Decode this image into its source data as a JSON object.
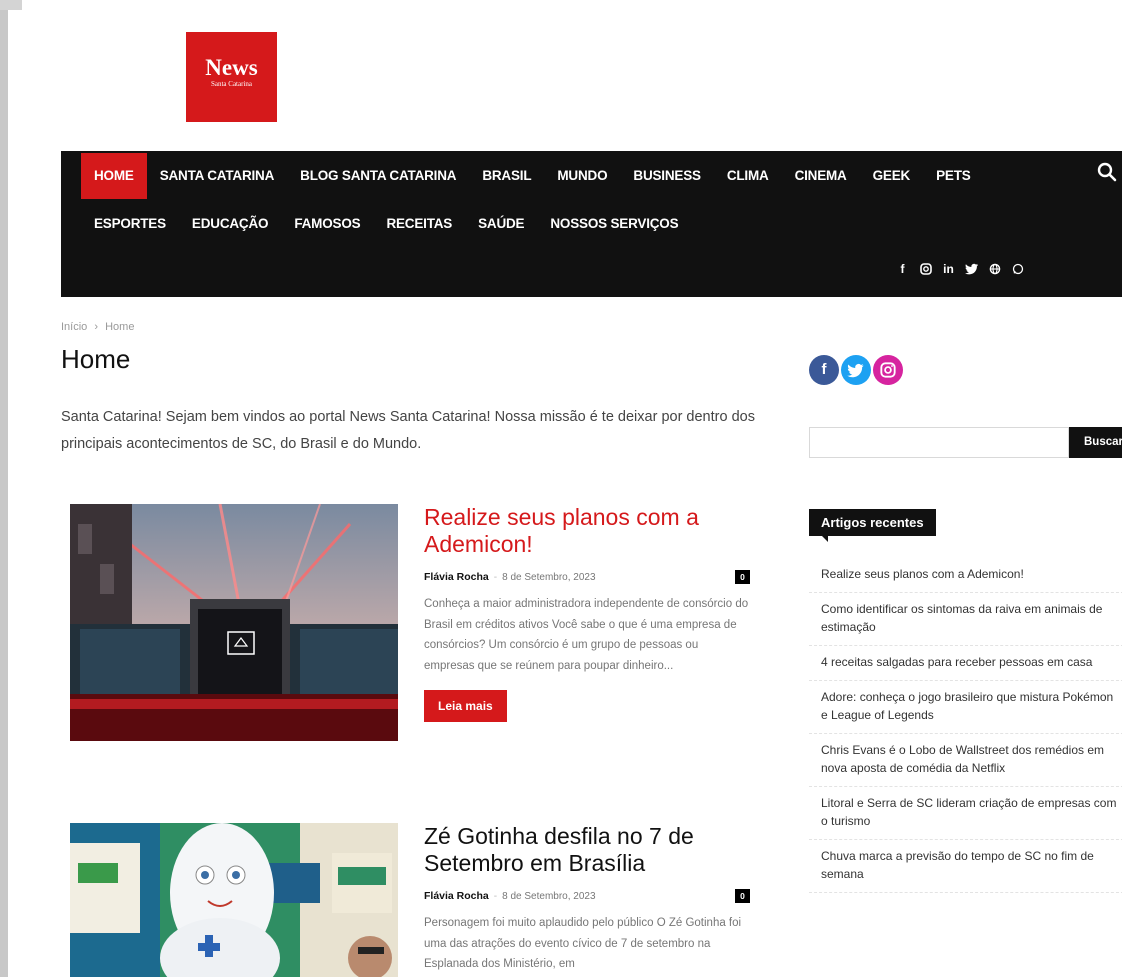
{
  "logo": {
    "main": "News",
    "sub": "Santa Catarina"
  },
  "nav": {
    "row1": [
      "HOME",
      "SANTA CATARINA",
      "BLOG SANTA CATARINA",
      "BRASIL",
      "MUNDO",
      "BUSINESS",
      "CLIMA",
      "CINEMA",
      "GEEK",
      "PETS"
    ],
    "row2": [
      "ESPORTES",
      "EDUCAÇÃO",
      "FAMOSOS",
      "RECEITAS",
      "SAÚDE",
      "NOSSOS SERVIÇOS"
    ],
    "active": "HOME",
    "social_icons": [
      "facebook-icon",
      "instagram-icon",
      "linkedin-icon",
      "twitter-icon",
      "globe-icon",
      "whatsapp-icon"
    ]
  },
  "breadcrumb": {
    "home": "Início",
    "separator": "›",
    "current": "Home"
  },
  "page_title": "Home",
  "intro": "Santa Catarina! Sejam bem vindos ao portal News Santa Catarina! Nossa missão é te deixar por dentro dos principais acontecimentos de SC, do Brasil e do Mundo.",
  "posts": [
    {
      "title": "Realize seus planos com a Ademicon!",
      "author": "Flávia Rocha",
      "date": "8 de Setembro, 2023",
      "comments": "0",
      "excerpt": "Conheça a maior administradora independente de consórcio do Brasil em créditos ativos Você sabe o que é uma empresa de consórcios? Um consórcio é um grupo de pessoas ou empresas que se reúnem para poupar dinheiro...",
      "read_more": "Leia mais"
    },
    {
      "title": "Zé Gotinha desfila no 7 de Setembro em Brasília",
      "author": "Flávia Rocha",
      "date": "8 de Setembro, 2023",
      "comments": "0",
      "excerpt": "Personagem foi muito aplaudido pelo público O Zé Gotinha foi uma das atrações do evento cívico de 7 de setembro na Esplanada dos Ministério, em"
    }
  ],
  "sidebar": {
    "search_button": "Buscar",
    "search_value": "",
    "recent_heading": "Artigos recentes",
    "recent": [
      "Realize seus planos com a Ademicon!",
      "Como identificar os sintomas da raiva em animais de estimação",
      "4 receitas salgadas para receber pessoas em casa",
      "Adore: conheça o jogo brasileiro que mistura Pokémon e League of Legends",
      "Chris Evans é o Lobo de Wallstreet dos remédios em nova aposta de comédia da Netflix",
      "Litoral e Serra de SC lideram criação de empresas com o turismo",
      "Chuva marca a previsão do tempo de SC no fim de semana"
    ]
  },
  "colors": {
    "brand_red": "#d5191b",
    "nav_bg": "#111111",
    "facebook": "#3b5998",
    "twitter": "#1da1f2",
    "instagram": "#d6249f"
  }
}
